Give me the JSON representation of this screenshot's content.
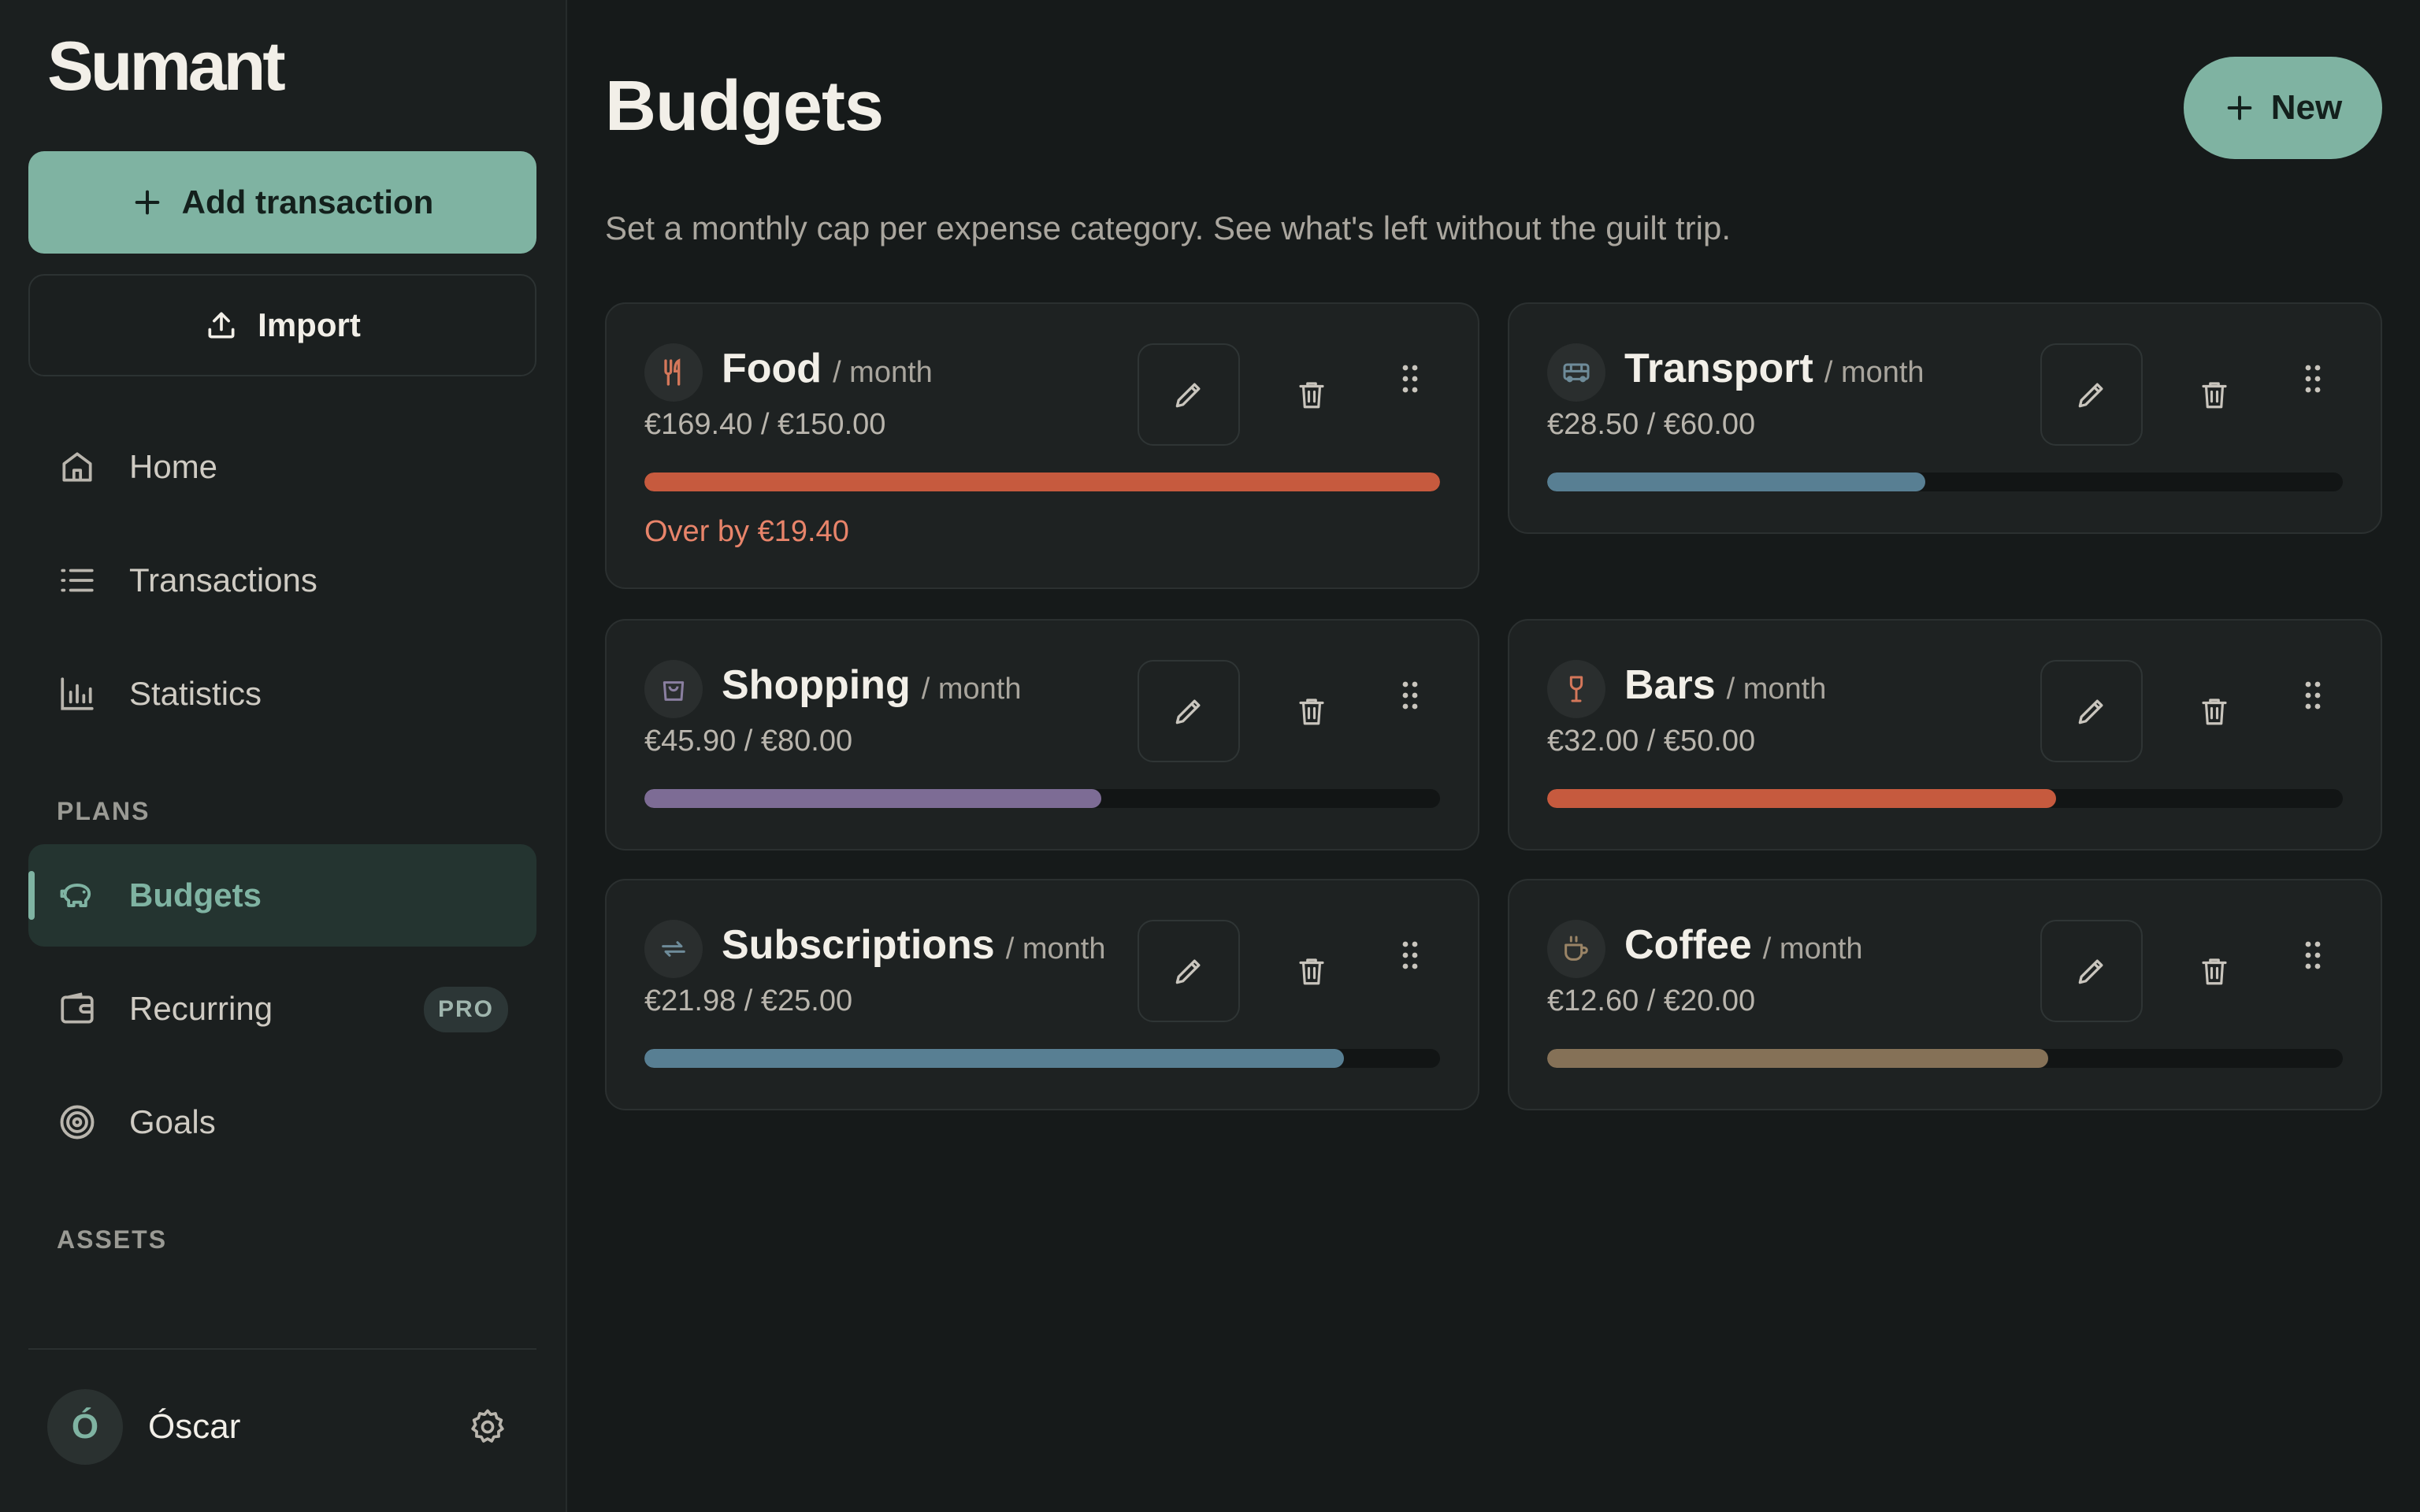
{
  "app": {
    "logo": "Sumant"
  },
  "sidebar": {
    "add_transaction_label": "Add transaction",
    "import_label": "Import",
    "nav": [
      {
        "label": "Home",
        "icon": "home-icon"
      },
      {
        "label": "Transactions",
        "icon": "list-icon"
      },
      {
        "label": "Statistics",
        "icon": "bar-chart-icon"
      }
    ],
    "plans_label": "PLANS",
    "plans": [
      {
        "label": "Budgets",
        "icon": "piggy-bank-icon",
        "active": true
      },
      {
        "label": "Recurring",
        "icon": "wallet-icon",
        "badge": "PRO"
      },
      {
        "label": "Goals",
        "icon": "target-icon"
      }
    ],
    "assets_label": "ASSETS",
    "user": {
      "initial": "Ó",
      "name": "Óscar"
    }
  },
  "main": {
    "title": "Budgets",
    "new_label": "New",
    "subtitle": "Set a monthly cap per expense category. See what's left without the guilt trip."
  },
  "budgets": [
    {
      "name": "Food",
      "period": "/ month",
      "amount": "€169.40 / €150.00",
      "progress": 1.0,
      "color": "#c65a3e",
      "icon": "fork-knife-icon",
      "icon_color": "#d4775a",
      "over_text": "Over by €19.40"
    },
    {
      "name": "Transport",
      "period": "/ month",
      "amount": "€28.50 / €60.00",
      "progress": 0.475,
      "color": "#587f93",
      "icon": "bus-icon",
      "icon_color": "#6e8b99"
    },
    {
      "name": "Shopping",
      "period": "/ month",
      "amount": "€45.90 / €80.00",
      "progress": 0.574,
      "color": "#7d6c95",
      "icon": "shopping-bag-icon",
      "icon_color": "#8a7fa0"
    },
    {
      "name": "Bars",
      "period": "/ month",
      "amount": "€32.00 / €50.00",
      "progress": 0.64,
      "color": "#c65a3e",
      "icon": "wine-glass-icon",
      "icon_color": "#d4775a"
    },
    {
      "name": "Subscriptions",
      "period": "/ month",
      "amount": "€21.98 / €25.00",
      "progress": 0.879,
      "color": "#587f93",
      "icon": "repeat-icon",
      "icon_color": "#6e8b99"
    },
    {
      "name": "Coffee",
      "period": "/ month",
      "amount": "€12.60 / €20.00",
      "progress": 0.63,
      "color": "#857157",
      "icon": "coffee-cup-icon",
      "icon_color": "#9a8466"
    }
  ]
}
